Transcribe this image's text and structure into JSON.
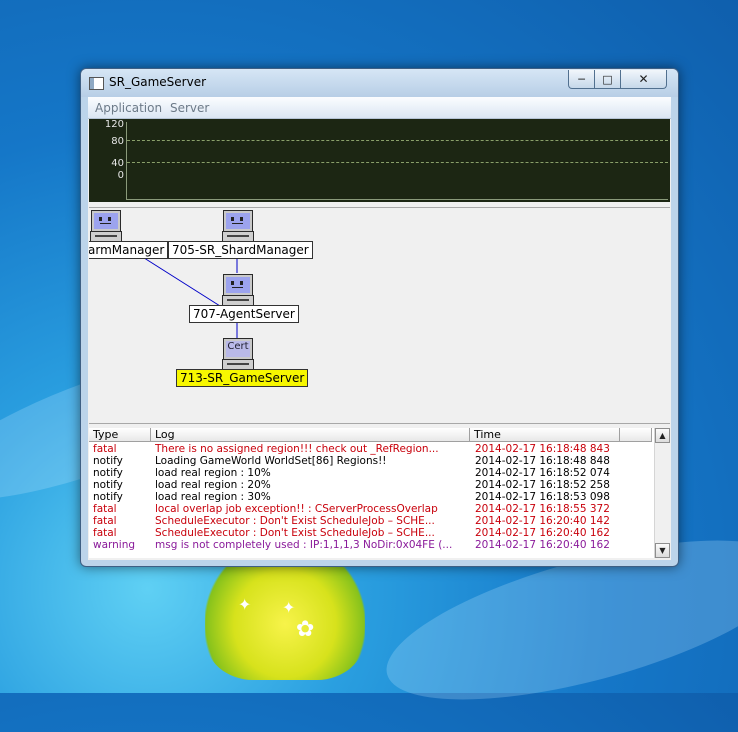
{
  "window": {
    "title": "SR_GameServer",
    "controls": {
      "minimize": "─",
      "maximize": "□",
      "close": "✕"
    }
  },
  "menu": {
    "items": [
      "Application",
      "Server"
    ]
  },
  "graph": {
    "y_labels": [
      "120",
      "80",
      "40",
      "0"
    ],
    "colors": {
      "background": "#1c2613",
      "grid": "#8aa06a"
    }
  },
  "topology": {
    "nodes": [
      {
        "label": "armManager",
        "icon": "monitor-face-icon",
        "highlight": false
      },
      {
        "label": "705-SR_ShardManager",
        "icon": "monitor-face-icon",
        "highlight": false
      },
      {
        "label": "707-AgentServer",
        "icon": "monitor-face-icon",
        "highlight": false
      },
      {
        "label": "713-SR_GameServer",
        "icon": "cert-monitor-icon",
        "icon_text": "Cert",
        "highlight": true
      }
    ]
  },
  "log": {
    "columns": [
      "Type",
      "Log",
      "Time"
    ],
    "rows": [
      {
        "type": "fatal",
        "log": "There is no assigned region!!! check out _RefRegion...",
        "time": "2014-02-17 16:18:48 843"
      },
      {
        "type": "notify",
        "log": "Loading GameWorld WorldSet[86] Regions!!",
        "time": "2014-02-17 16:18:48 848"
      },
      {
        "type": "notify",
        "log": "load real region : 10%",
        "time": "2014-02-17 16:18:52 074"
      },
      {
        "type": "notify",
        "log": "load real region : 20%",
        "time": "2014-02-17 16:18:52 258"
      },
      {
        "type": "notify",
        "log": "load real region : 30%",
        "time": "2014-02-17 16:18:53 098"
      },
      {
        "type": "fatal",
        "log": "local overlap job exception!! : CServerProcessOverlap",
        "time": "2014-02-17 16:18:55 372"
      },
      {
        "type": "fatal",
        "log": "ScheduleExecutor : Don't Exist ScheduleJob – SCHE...",
        "time": "2014-02-17 16:20:40 142"
      },
      {
        "type": "fatal",
        "log": "ScheduleExecutor : Don't Exist ScheduleJob – SCHE...",
        "time": "2014-02-17 16:20:40 162"
      },
      {
        "type": "warning",
        "log": "msg is not completely used : IP:1,1,1,3 NoDir:0x04FE (...",
        "time": "2014-02-17 16:20:40 162"
      }
    ],
    "scroll": {
      "up": "▲",
      "down": "▼"
    },
    "colors": {
      "fatal": "#c8000b",
      "notify": "#000000",
      "warning": "#8a1a9a"
    }
  }
}
